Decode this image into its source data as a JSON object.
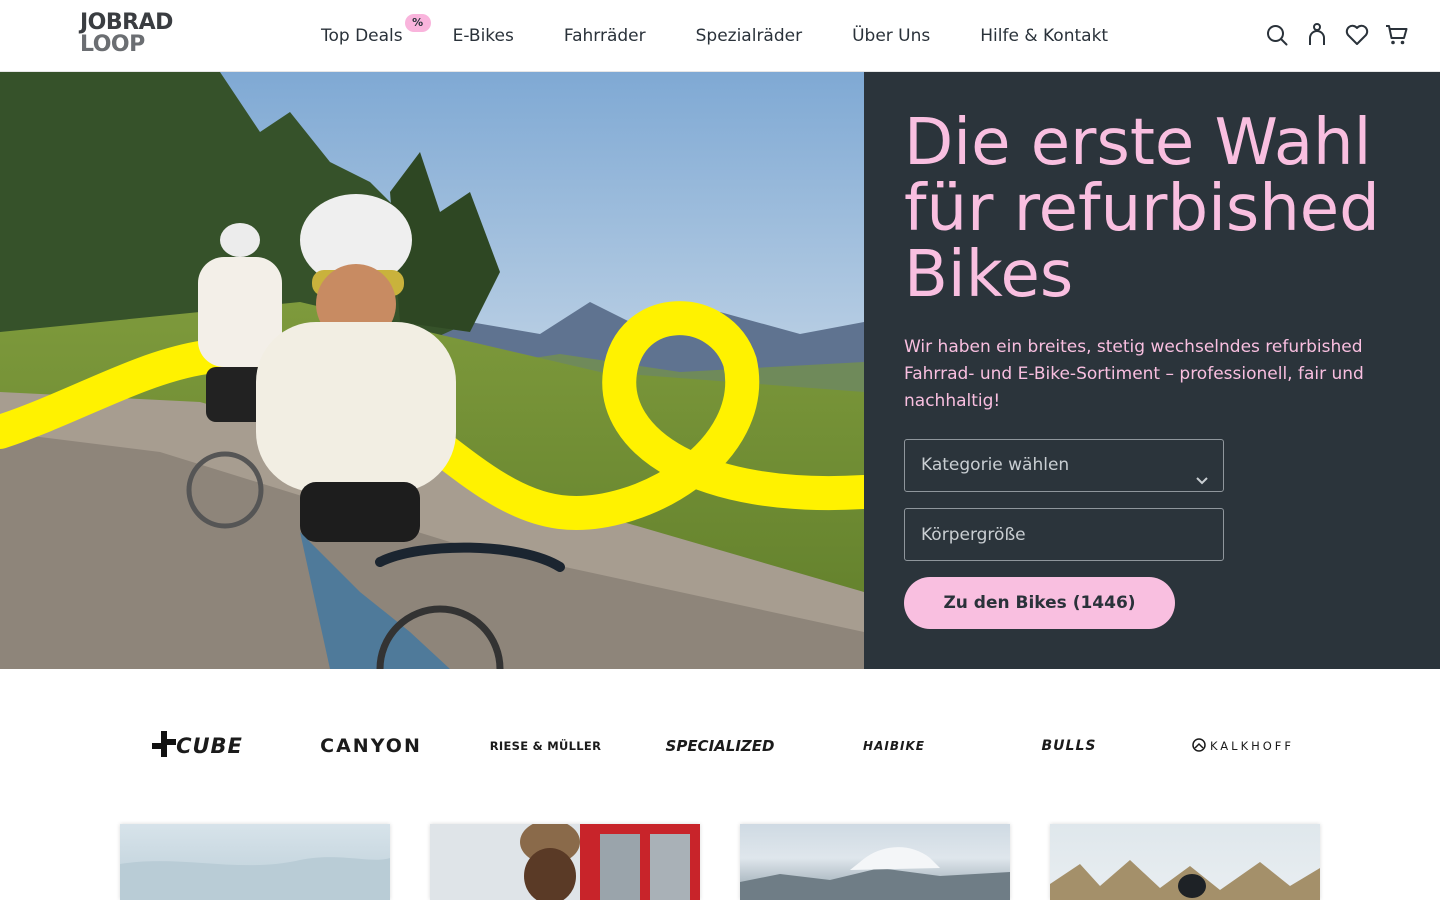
{
  "logo": {
    "line1": "JOBRAD",
    "line2": "LOOP"
  },
  "nav": {
    "items": [
      {
        "label": "Top Deals",
        "badge": "%"
      },
      {
        "label": "E-Bikes"
      },
      {
        "label": "Fahrräder"
      },
      {
        "label": "Spezialräder"
      },
      {
        "label": "Über Uns"
      },
      {
        "label": "Hilfe & Kontakt"
      }
    ]
  },
  "header_icons": [
    "search-icon",
    "account-icon",
    "heart-icon",
    "cart-icon"
  ],
  "hero": {
    "title": "Die erste Wahl für refurbished Bikes",
    "subtitle": "Wir haben ein breites, stetig wechselndes refurbished Fahrrad- und E-Bike-Sortiment – professionell, fair und nachhaltig!",
    "category_select": {
      "value": "Kategorie wählen"
    },
    "height_input": {
      "placeholder": "Körpergröße"
    },
    "cta_label": "Zu den Bikes (1446)"
  },
  "brands": [
    "CUBE",
    "CANYON",
    "RIESE & MÜLLER",
    "SPECIALIZED",
    "HAIBIKE",
    "BULLS",
    "KALKHOFF"
  ],
  "colors": {
    "accent_pink": "#f9bfe0",
    "panel_dark": "#2b343b",
    "highlight_yellow": "#fff200",
    "text_dark": "#2a323a"
  }
}
